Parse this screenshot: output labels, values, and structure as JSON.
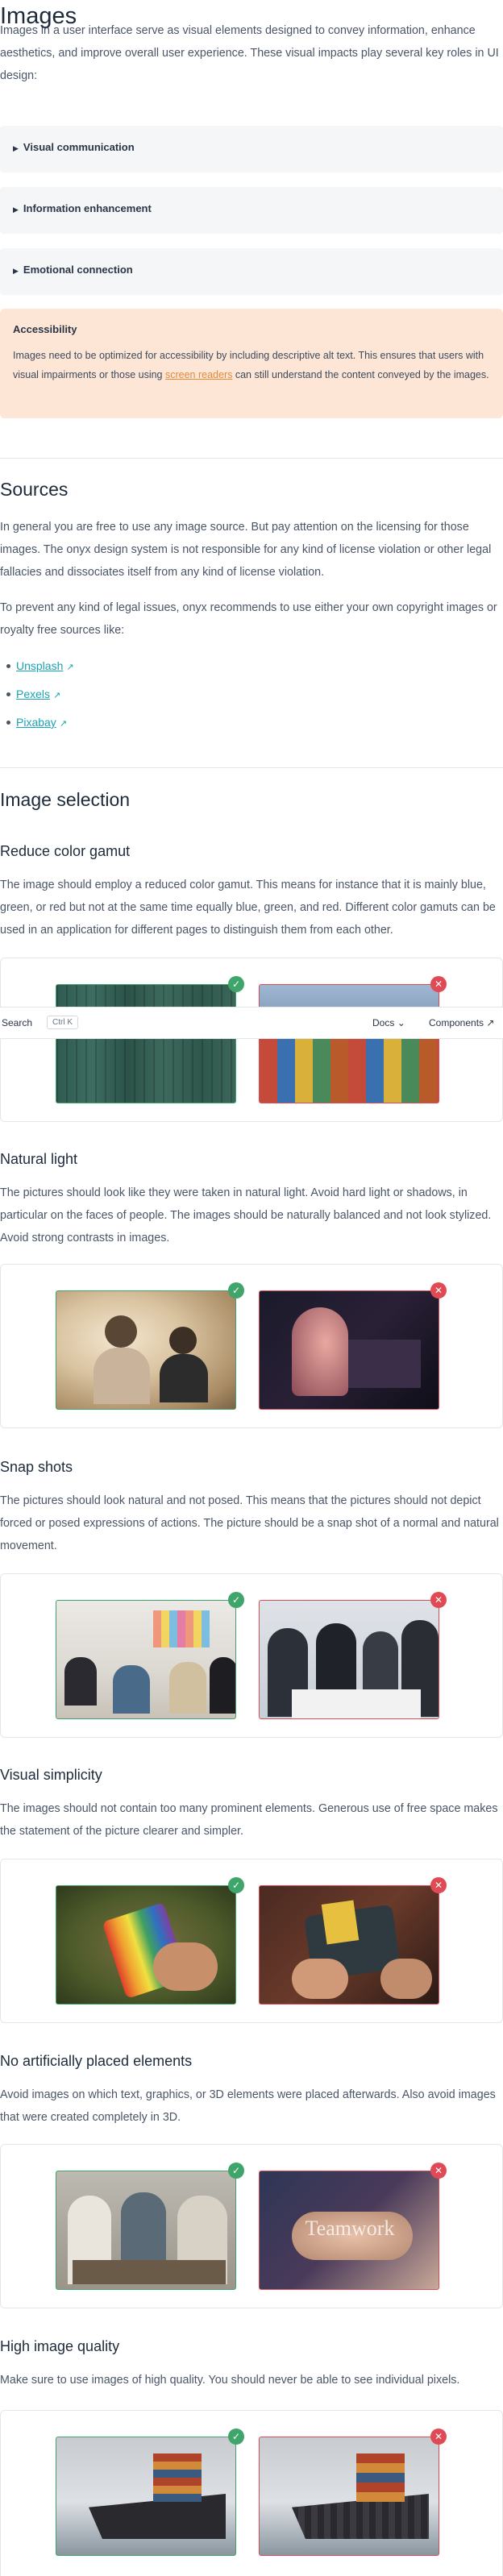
{
  "images": {
    "title": "Images",
    "intro": "Images in a user interface serve as visual elements designed to convey information, enhance aesthetics, and improve overall user experience. These visual impacts play several key roles in UI design:",
    "details": [
      "Visual communication",
      "Information enhancement",
      "Emotional connection"
    ],
    "accessibility": {
      "title": "Accessibility",
      "text_before": "Images need to be optimized for accessibility by including descriptive alt text. This ensures that users with visual impairments or those using ",
      "link": "screen readers",
      "text_after": " can still understand the content conveyed by the images."
    }
  },
  "sources": {
    "title": "Sources",
    "p1": "In general you are free to use any image source. But pay attention on the licensing for those images. The onyx design system is not responsible for any kind of license violation or other legal fallacies and dissociates itself from any kind of license violation.",
    "p2": "To prevent any kind of legal issues, onyx recommends to use either your own copyright images or royalty free sources like:",
    "links": [
      "Unsplash",
      "Pexels",
      "Pixabay"
    ],
    "ext_icon": "↗"
  },
  "selection": {
    "title": "Image selection",
    "sections": [
      {
        "title": "Reduce color gamut",
        "text": "The image should employ a reduced color gamut. This means for instance that it is mainly blue, green, or red but not at the same time equally blue, green, and red. Different color gamuts can be used in an application for different pages to distinguish them from each other."
      },
      {
        "title": "Natural light",
        "text": "The pictures should look like they were taken in natural light. Avoid hard light or shadows, in particular on the faces of people. The images should be naturally balanced and not look stylized. Avoid strong contrasts in images."
      },
      {
        "title": "Snap shots",
        "text": "The pictures should look natural and not posed. This means that the pictures should not depict forced or posed expressions of actions. The picture should be a snap shot of a normal and natural movement."
      },
      {
        "title": "Visual simplicity",
        "text": "The images should not contain too many prominent elements. Generous use of free space makes the statement of the picture clearer and simpler."
      },
      {
        "title": "No artificially placed elements",
        "text": "Avoid images on which text, graphics, or 3D elements were placed afterwards. Also avoid images that were created completely in 3D."
      },
      {
        "title": "High image quality",
        "text": "Make sure to use images of high quality. You should never be able to see individual pixels."
      }
    ],
    "teamwork_overlay": "Teamwork"
  },
  "topbar": {
    "search_label": "Search",
    "shortcut": "Ctrl K",
    "docs": "Docs",
    "components": "Components",
    "chevron": "⌄",
    "ext_icon": "↗"
  },
  "badges": {
    "ok": "✓",
    "no": "✕"
  },
  "colors": {
    "good": "#3fa56b",
    "bad": "#e04a55",
    "link": "#1aa3b3",
    "callout_bg": "#fde6d6"
  }
}
